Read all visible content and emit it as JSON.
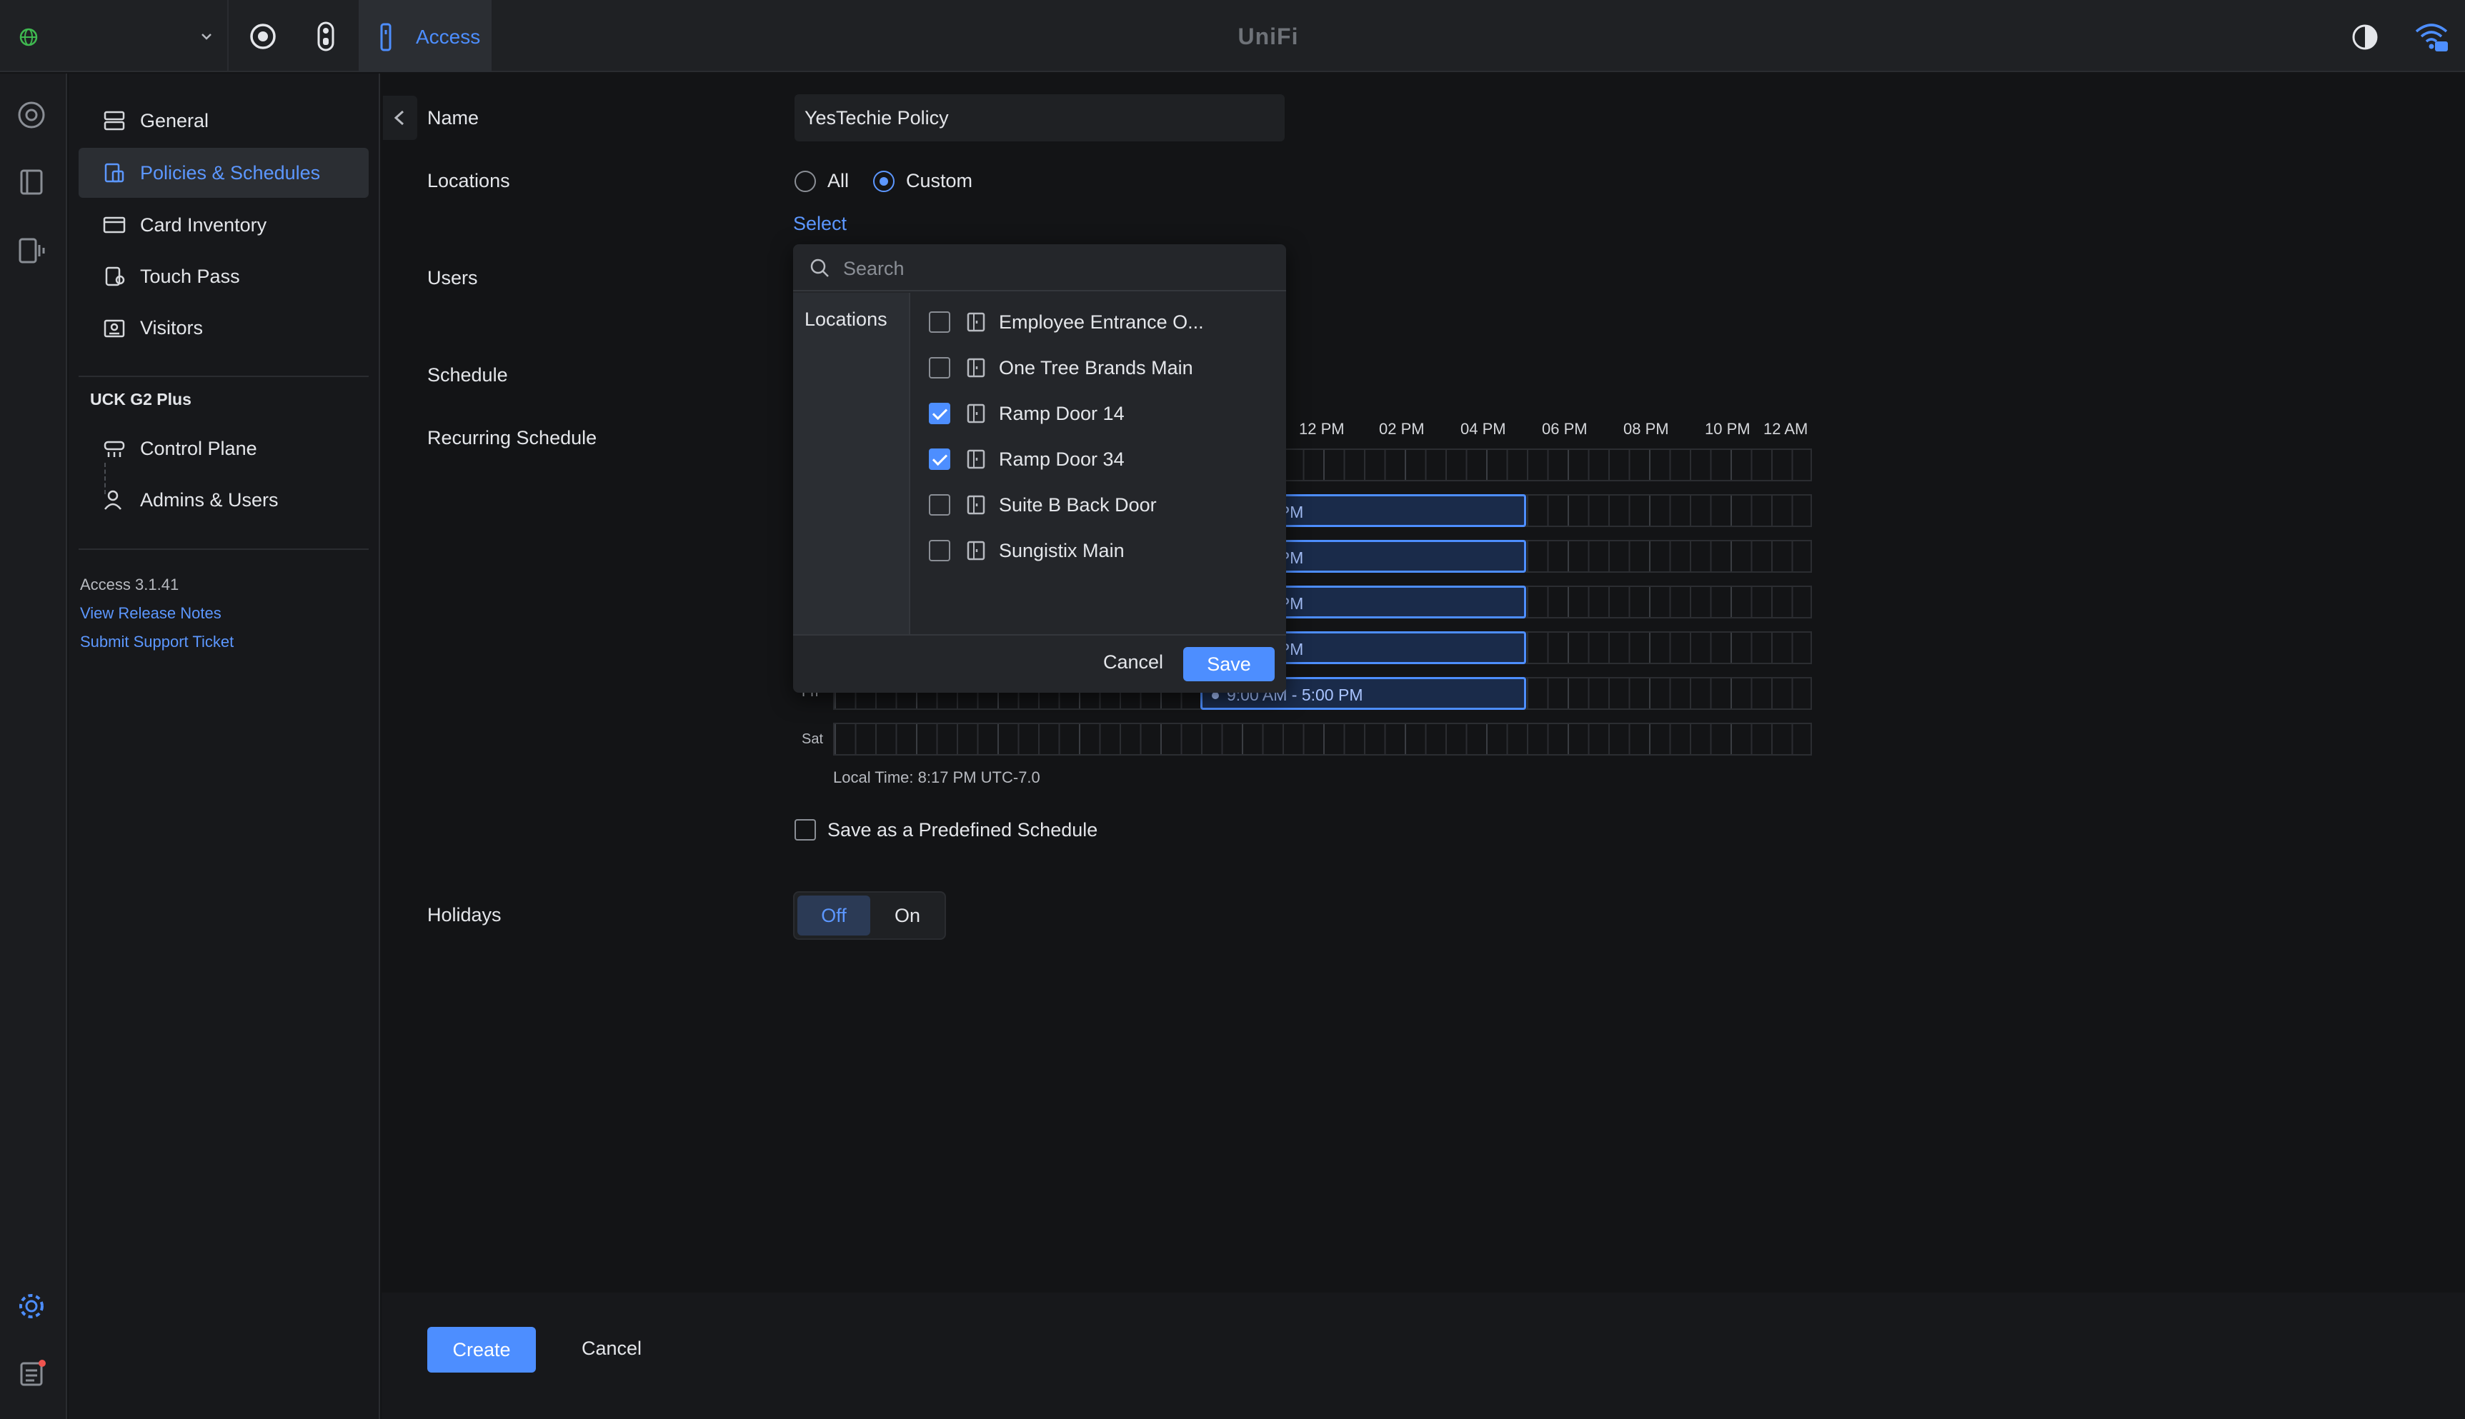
{
  "topbar": {
    "app_title": "UniFi",
    "active_app": "Access",
    "icons": [
      "globe-icon",
      "chevron-down-icon",
      "protect-icon",
      "doorbell-icon",
      "access-reader-icon",
      "contrast-icon",
      "wifi-icon"
    ]
  },
  "sidebar": {
    "items": [
      {
        "label": "General",
        "icon": "server-icon"
      },
      {
        "label": "Policies & Schedules",
        "icon": "policy-icon",
        "active": true
      },
      {
        "label": "Card Inventory",
        "icon": "card-icon"
      },
      {
        "label": "Touch Pass",
        "icon": "touch-pass-icon"
      },
      {
        "label": "Visitors",
        "icon": "visitor-icon"
      }
    ],
    "device_heading": "UCK G2 Plus",
    "device_items": [
      {
        "label": "Control Plane",
        "icon": "control-plane-icon"
      },
      {
        "label": "Admins & Users",
        "icon": "admins-icon"
      }
    ],
    "version": "Access 3.1.41",
    "release_notes": "View Release Notes",
    "support_ticket": "Submit Support Ticket"
  },
  "form": {
    "name_label": "Name",
    "name_value": "YesTechie Policy",
    "locations_label": "Locations",
    "locations_all": "All",
    "locations_custom": "Custom",
    "locations_selected": "Custom",
    "select_link": "Select",
    "users_label": "Users",
    "schedule_label": "Schedule",
    "recurring_label": "Recurring Schedule",
    "holidays_label": "Holidays",
    "holidays_off": "Off",
    "holidays_on": "On",
    "holidays_state": "Off",
    "predefined_label": "Save as a Predefined Schedule",
    "predefined_checked": false
  },
  "schedule": {
    "time_labels": [
      "12 PM",
      "02 PM",
      "04 PM",
      "06 PM",
      "08 PM",
      "10 PM",
      "12 AM"
    ],
    "partial_day_label": "Fri",
    "sat_label": "Sat",
    "block_text_partial": "M - 5:00 PM",
    "block_text_fri": "9:00 AM - 5:00 PM",
    "local_time": "Local Time: 8:17 PM UTC-7.0"
  },
  "popover": {
    "search_placeholder": "Search",
    "category": "Locations",
    "options": [
      {
        "label": "Employee Entrance O...",
        "checked": false
      },
      {
        "label": "One Tree Brands Main",
        "checked": false
      },
      {
        "label": "Ramp Door 14",
        "checked": true
      },
      {
        "label": "Ramp Door 34",
        "checked": true
      },
      {
        "label": "Suite B Back Door",
        "checked": false
      },
      {
        "label": "Sungistix Main",
        "checked": false
      }
    ],
    "cancel": "Cancel",
    "save": "Save"
  },
  "footer": {
    "create": "Create",
    "cancel": "Cancel"
  },
  "colors": {
    "accent": "#4d8eff",
    "background": "#131416",
    "panel": "#1f2124"
  }
}
